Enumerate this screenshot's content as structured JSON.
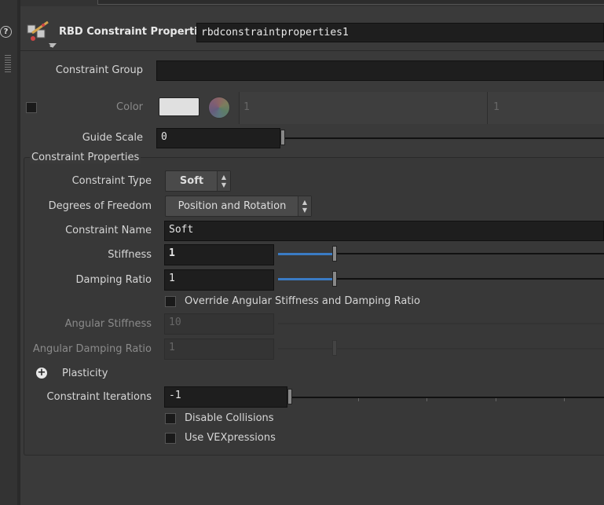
{
  "node": {
    "type_label": "RBD Constraint Properties",
    "name": "rbdconstraintproperties1",
    "icon": "rbd-constraint-node-icon"
  },
  "help_label": "?",
  "params": {
    "constraint_group": {
      "label": "Constraint Group",
      "value": ""
    },
    "color": {
      "label": "Color",
      "value1": "1",
      "value2": "1",
      "swatch": "#e0e0e0"
    },
    "guide_scale": {
      "label": "Guide Scale",
      "value": "0"
    },
    "group_title": "Constraint Properties",
    "constraint_type": {
      "label": "Constraint Type",
      "value": "Soft"
    },
    "degrees_of_freedom": {
      "label": "Degrees of Freedom",
      "value": "Position and Rotation"
    },
    "constraint_name": {
      "label": "Constraint Name",
      "value": "Soft"
    },
    "stiffness": {
      "label": "Stiffness",
      "value": "1"
    },
    "damping_ratio": {
      "label": "Damping Ratio",
      "value": "1"
    },
    "override_angular": {
      "label": "Override Angular Stiffness and Damping Ratio"
    },
    "angular_stiffness": {
      "label": "Angular Stiffness",
      "value": "10"
    },
    "angular_damping_ratio": {
      "label": "Angular Damping Ratio",
      "value": "1"
    },
    "plasticity": {
      "label": "Plasticity"
    },
    "constraint_iterations": {
      "label": "Constraint Iterations",
      "value": "-1"
    },
    "disable_collisions": {
      "label": "Disable Collisions"
    },
    "use_vexpressions": {
      "label": "Use VEXpressions"
    }
  },
  "colors": {
    "accent": "#3a7bc4",
    "background": "#3a3a3a"
  }
}
